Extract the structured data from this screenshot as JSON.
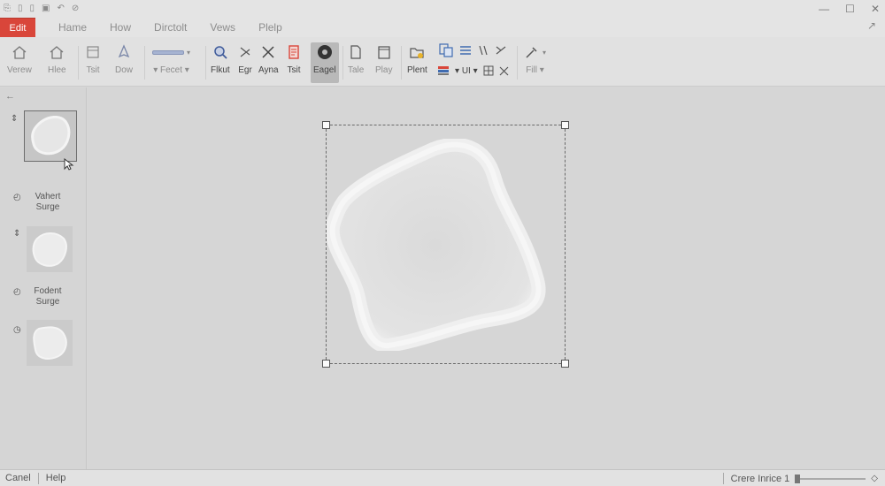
{
  "quick_access": [
    "⎘",
    "▯",
    "▯",
    "▣",
    "↶",
    "⊘"
  ],
  "window_controls": [
    "—",
    "☐",
    "✕"
  ],
  "menu": {
    "active": "Edit",
    "items": [
      "Hame",
      "How",
      "Dirctolt",
      "Vews",
      "Plelp"
    ],
    "pin": "↗"
  },
  "ribbon": {
    "buttons": [
      {
        "label": "Verew"
      },
      {
        "label": "Hlee"
      },
      {
        "label": "Tsit"
      },
      {
        "label": "Dow"
      },
      {
        "label": "Fecet"
      },
      {
        "label": "Flkut"
      },
      {
        "label": "Egr"
      },
      {
        "label": "Ayna"
      },
      {
        "label": "Tsit"
      },
      {
        "label": "Eagel"
      },
      {
        "label": "Tale"
      },
      {
        "label": "Play"
      },
      {
        "label": "Plent"
      },
      {
        "label": "UI"
      },
      {
        "label": "Fill"
      }
    ]
  },
  "sidebar": {
    "back": "←",
    "items": [
      {
        "label": "Vahert Surge"
      },
      {
        "label": "Fodent Surge"
      }
    ]
  },
  "status": {
    "left": "Canel",
    "help": "Help",
    "right": "Crere Inrice 1",
    "zoom_end": "◇",
    "zoom_level": 0
  },
  "colors": {
    "accent": "#d9463a",
    "background": "#d6d6d6"
  }
}
